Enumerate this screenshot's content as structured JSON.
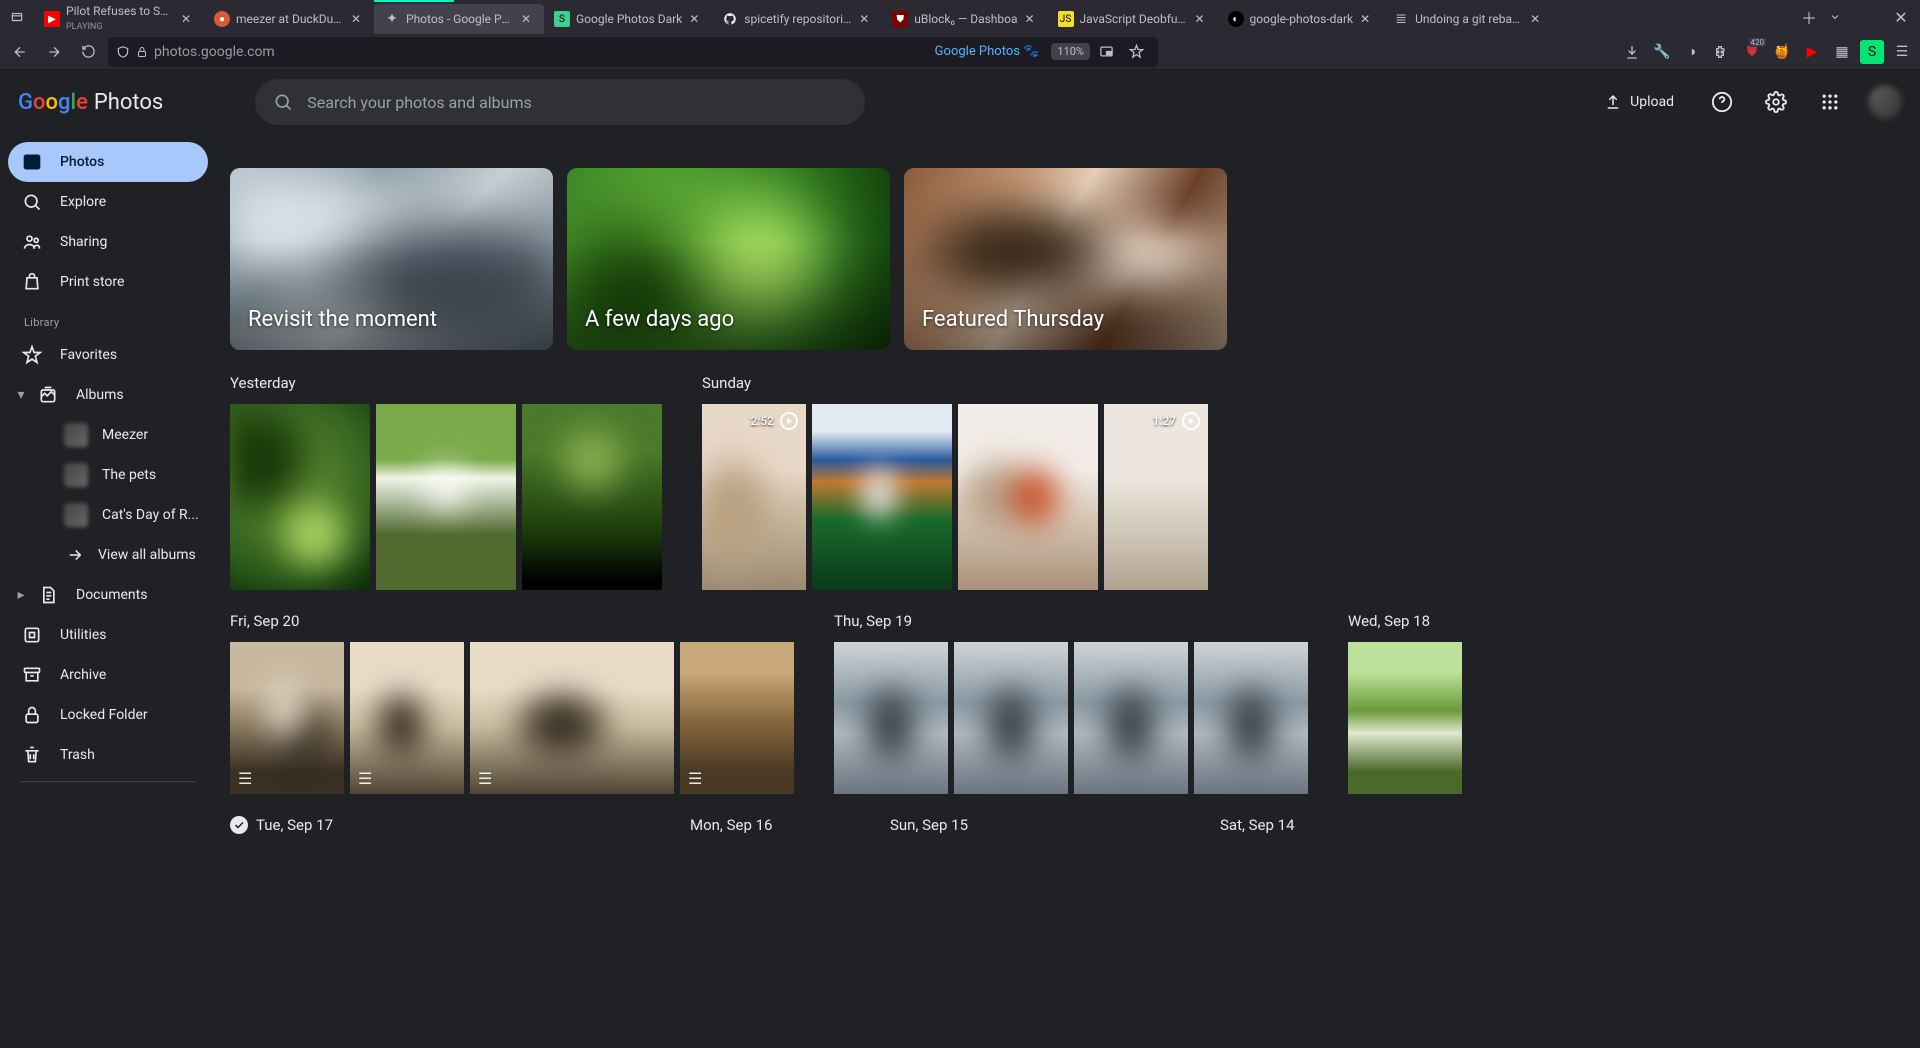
{
  "browser": {
    "url": "photos.google.com",
    "reader_mode_label": "Google Photos",
    "zoom": "110%",
    "ublock_badge": "420",
    "tabs": [
      {
        "title": "Pilot Refuses to Say t",
        "sub": "PLAYING",
        "icon": "yt"
      },
      {
        "title": "meezer at DuckDuck",
        "icon": "ddg"
      },
      {
        "title": "Photos - Google Pho",
        "icon": "gp",
        "active": true
      },
      {
        "title": "Google Photos Dark ",
        "icon": "sf"
      },
      {
        "title": "spicetify repositories",
        "icon": "gh"
      },
      {
        "title": "uBlock₀ — Dashboa",
        "icon": "ub"
      },
      {
        "title": "JavaScript Deobfusc",
        "icon": "js"
      },
      {
        "title": "google-photos-dark",
        "icon": "mn"
      },
      {
        "title": "Undoing a git rebase",
        "icon": "so"
      }
    ]
  },
  "header": {
    "product": "Photos",
    "search_placeholder": "Search your photos and albums",
    "upload_label": "Upload"
  },
  "sidebar": {
    "items": [
      {
        "label": "Photos",
        "icon": "image",
        "active": true
      },
      {
        "label": "Explore",
        "icon": "search"
      },
      {
        "label": "Sharing",
        "icon": "people"
      },
      {
        "label": "Print store",
        "icon": "bag"
      }
    ],
    "library_heading": "Library",
    "favorites": "Favorites",
    "albums": "Albums",
    "album_list": [
      {
        "label": "Meezer"
      },
      {
        "label": "The pets"
      },
      {
        "label": "Cat's Day of R..."
      }
    ],
    "view_all": "View all albums",
    "documents": "Documents",
    "utilities": "Utilities",
    "archive": "Archive",
    "locked": "Locked Folder",
    "trash": "Trash"
  },
  "memories": [
    {
      "title": "Revisit the moment"
    },
    {
      "title": "A few days ago"
    },
    {
      "title": "Featured Thursday"
    }
  ],
  "sections": {
    "yesterday": "Yesterday",
    "sunday": "Sunday",
    "fri": "Fri, Sep 20",
    "thu": "Thu, Sep 19",
    "wed": "Wed, Sep 18",
    "tue": "Tue, Sep 17",
    "mon": "Mon, Sep 16",
    "sun15": "Sun, Sep 15",
    "sat": "Sat, Sep 14"
  },
  "videos": {
    "sunday_1": "2:52",
    "sunday_4": "1:27"
  }
}
